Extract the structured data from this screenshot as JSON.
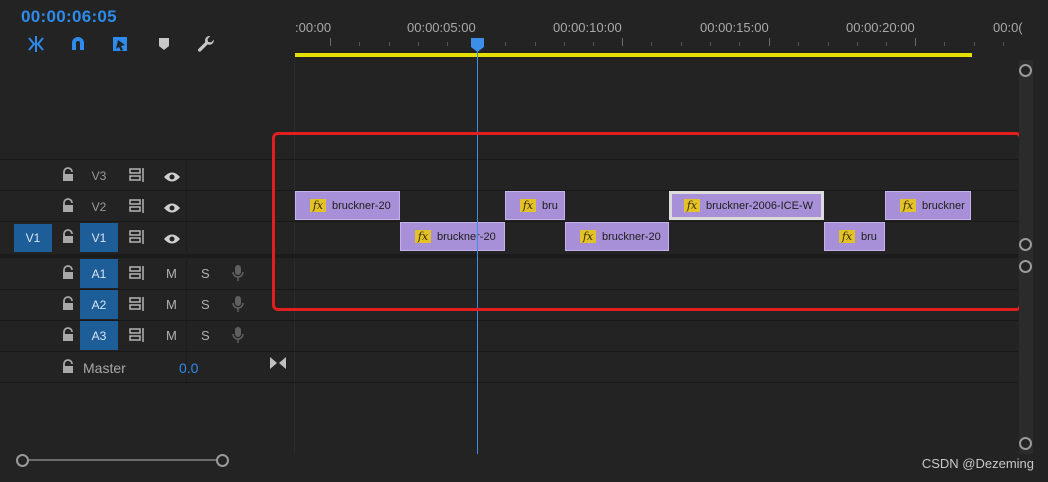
{
  "header": {
    "timecode": "00:00:06:05",
    "tools": [
      {
        "name": "insert-sequence-icon"
      },
      {
        "name": "snap-magnet-icon"
      },
      {
        "name": "linked-selection-icon"
      },
      {
        "name": "add-marker-icon"
      },
      {
        "name": "wrench-settings-icon"
      }
    ]
  },
  "ruler": {
    "labels": [
      ":00:00",
      "00:00:05:00",
      "00:00:10:00",
      "00:00:15:00",
      "00:00:20:00",
      "00:0("
    ]
  },
  "tracks": {
    "video": [
      {
        "name": "V3"
      },
      {
        "name": "V2"
      },
      {
        "name": "V1",
        "source_patch": "V1"
      }
    ],
    "audio": [
      {
        "name": "A1",
        "mute": "M",
        "solo": "S"
      },
      {
        "name": "A2",
        "mute": "M",
        "solo": "S"
      },
      {
        "name": "A3",
        "mute": "M",
        "solo": "S"
      }
    ],
    "master": {
      "label": "Master",
      "value": "0.0"
    }
  },
  "clips": {
    "v2": [
      {
        "label": "bruckner-20"
      },
      {
        "label": "bru"
      },
      {
        "label": "bruckner-2006-ICE-W"
      },
      {
        "label": "bruckner"
      }
    ],
    "v1": [
      {
        "label": "bruckner-20"
      },
      {
        "label": "bruckner-20"
      },
      {
        "label": "bru"
      }
    ],
    "fx_badge": "fx"
  },
  "playhead": {
    "time": "00:00:06:05"
  },
  "colors": {
    "timecode": "#2d8ceb",
    "clip": "#a890d8",
    "fx_badge": "#e3c228",
    "work_area": "#e5e000",
    "patch_active": "#1d5e99",
    "highlight_box": "#e11f1f"
  },
  "watermark": "CSDN @Dezeming"
}
